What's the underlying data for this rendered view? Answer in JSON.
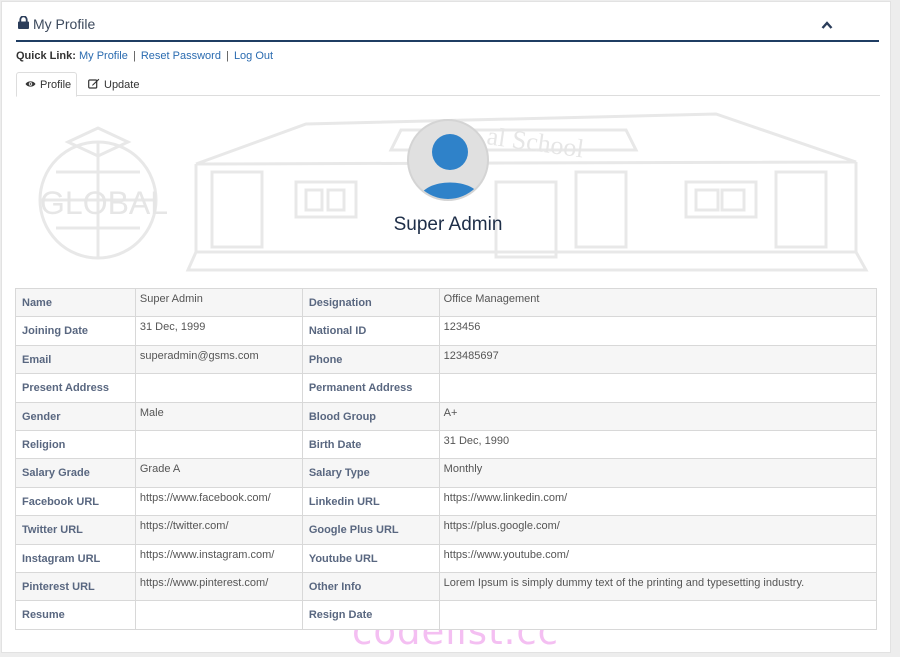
{
  "header": {
    "title": "My Profile",
    "lock_icon": "lock-icon",
    "collapse_icon": "chevron-up-icon"
  },
  "quick_links": {
    "label": "Quick Link:",
    "links": [
      "My Profile",
      "Reset Password",
      "Log Out"
    ],
    "separator": "|"
  },
  "tabs": [
    {
      "label": "Profile",
      "icon": "eye-icon",
      "active": true
    },
    {
      "label": "Update",
      "icon": "edit-icon",
      "active": false
    }
  ],
  "banner": {
    "watermark_text": "GLOBAL",
    "school_text": "al School",
    "user_name": "Super Admin"
  },
  "profile_rows": [
    {
      "l1": "Name",
      "v1": "Super Admin",
      "l2": "Designation",
      "v2": "Office Management"
    },
    {
      "l1": "Joining Date",
      "v1": "31 Dec, 1999",
      "l2": "National ID",
      "v2": "123456"
    },
    {
      "l1": "Email",
      "v1": "superadmin@gsms.com",
      "l2": "Phone",
      "v2": "123485697"
    },
    {
      "l1": "Present Address",
      "v1": "",
      "l2": "Permanent Address",
      "v2": ""
    },
    {
      "l1": "Gender",
      "v1": "Male",
      "l2": "Blood Group",
      "v2": "A+"
    },
    {
      "l1": "Religion",
      "v1": "",
      "l2": "Birth Date",
      "v2": "31 Dec, 1990"
    },
    {
      "l1": "Salary Grade",
      "v1": "Grade A",
      "l2": "Salary Type",
      "v2": "Monthly"
    },
    {
      "l1": "Facebook URL",
      "v1": "https://www.facebook.com/",
      "l2": "Linkedin URL",
      "v2": "https://www.linkedin.com/"
    },
    {
      "l1": "Twitter URL",
      "v1": "https://twitter.com/",
      "l2": "Google Plus URL",
      "v2": "https://plus.google.com/"
    },
    {
      "l1": "Instagram URL",
      "v1": "https://www.instagram.com/",
      "l2": "Youtube URL",
      "v2": "https://www.youtube.com/"
    },
    {
      "l1": "Pinterest URL",
      "v1": "https://www.pinterest.com/",
      "l2": "Other Info",
      "v2": "Lorem Ipsum is simply dummy text of the printing and typesetting industry."
    },
    {
      "l1": "Resume",
      "v1": "",
      "l2": "Resign Date",
      "v2": ""
    }
  ],
  "watermark": "codelist.cc",
  "colors": {
    "accent": "#1f3d63",
    "link": "#2a6bb0",
    "avatar": "#2f82c9",
    "label": "#596780",
    "watermark": "#f4bff2"
  }
}
